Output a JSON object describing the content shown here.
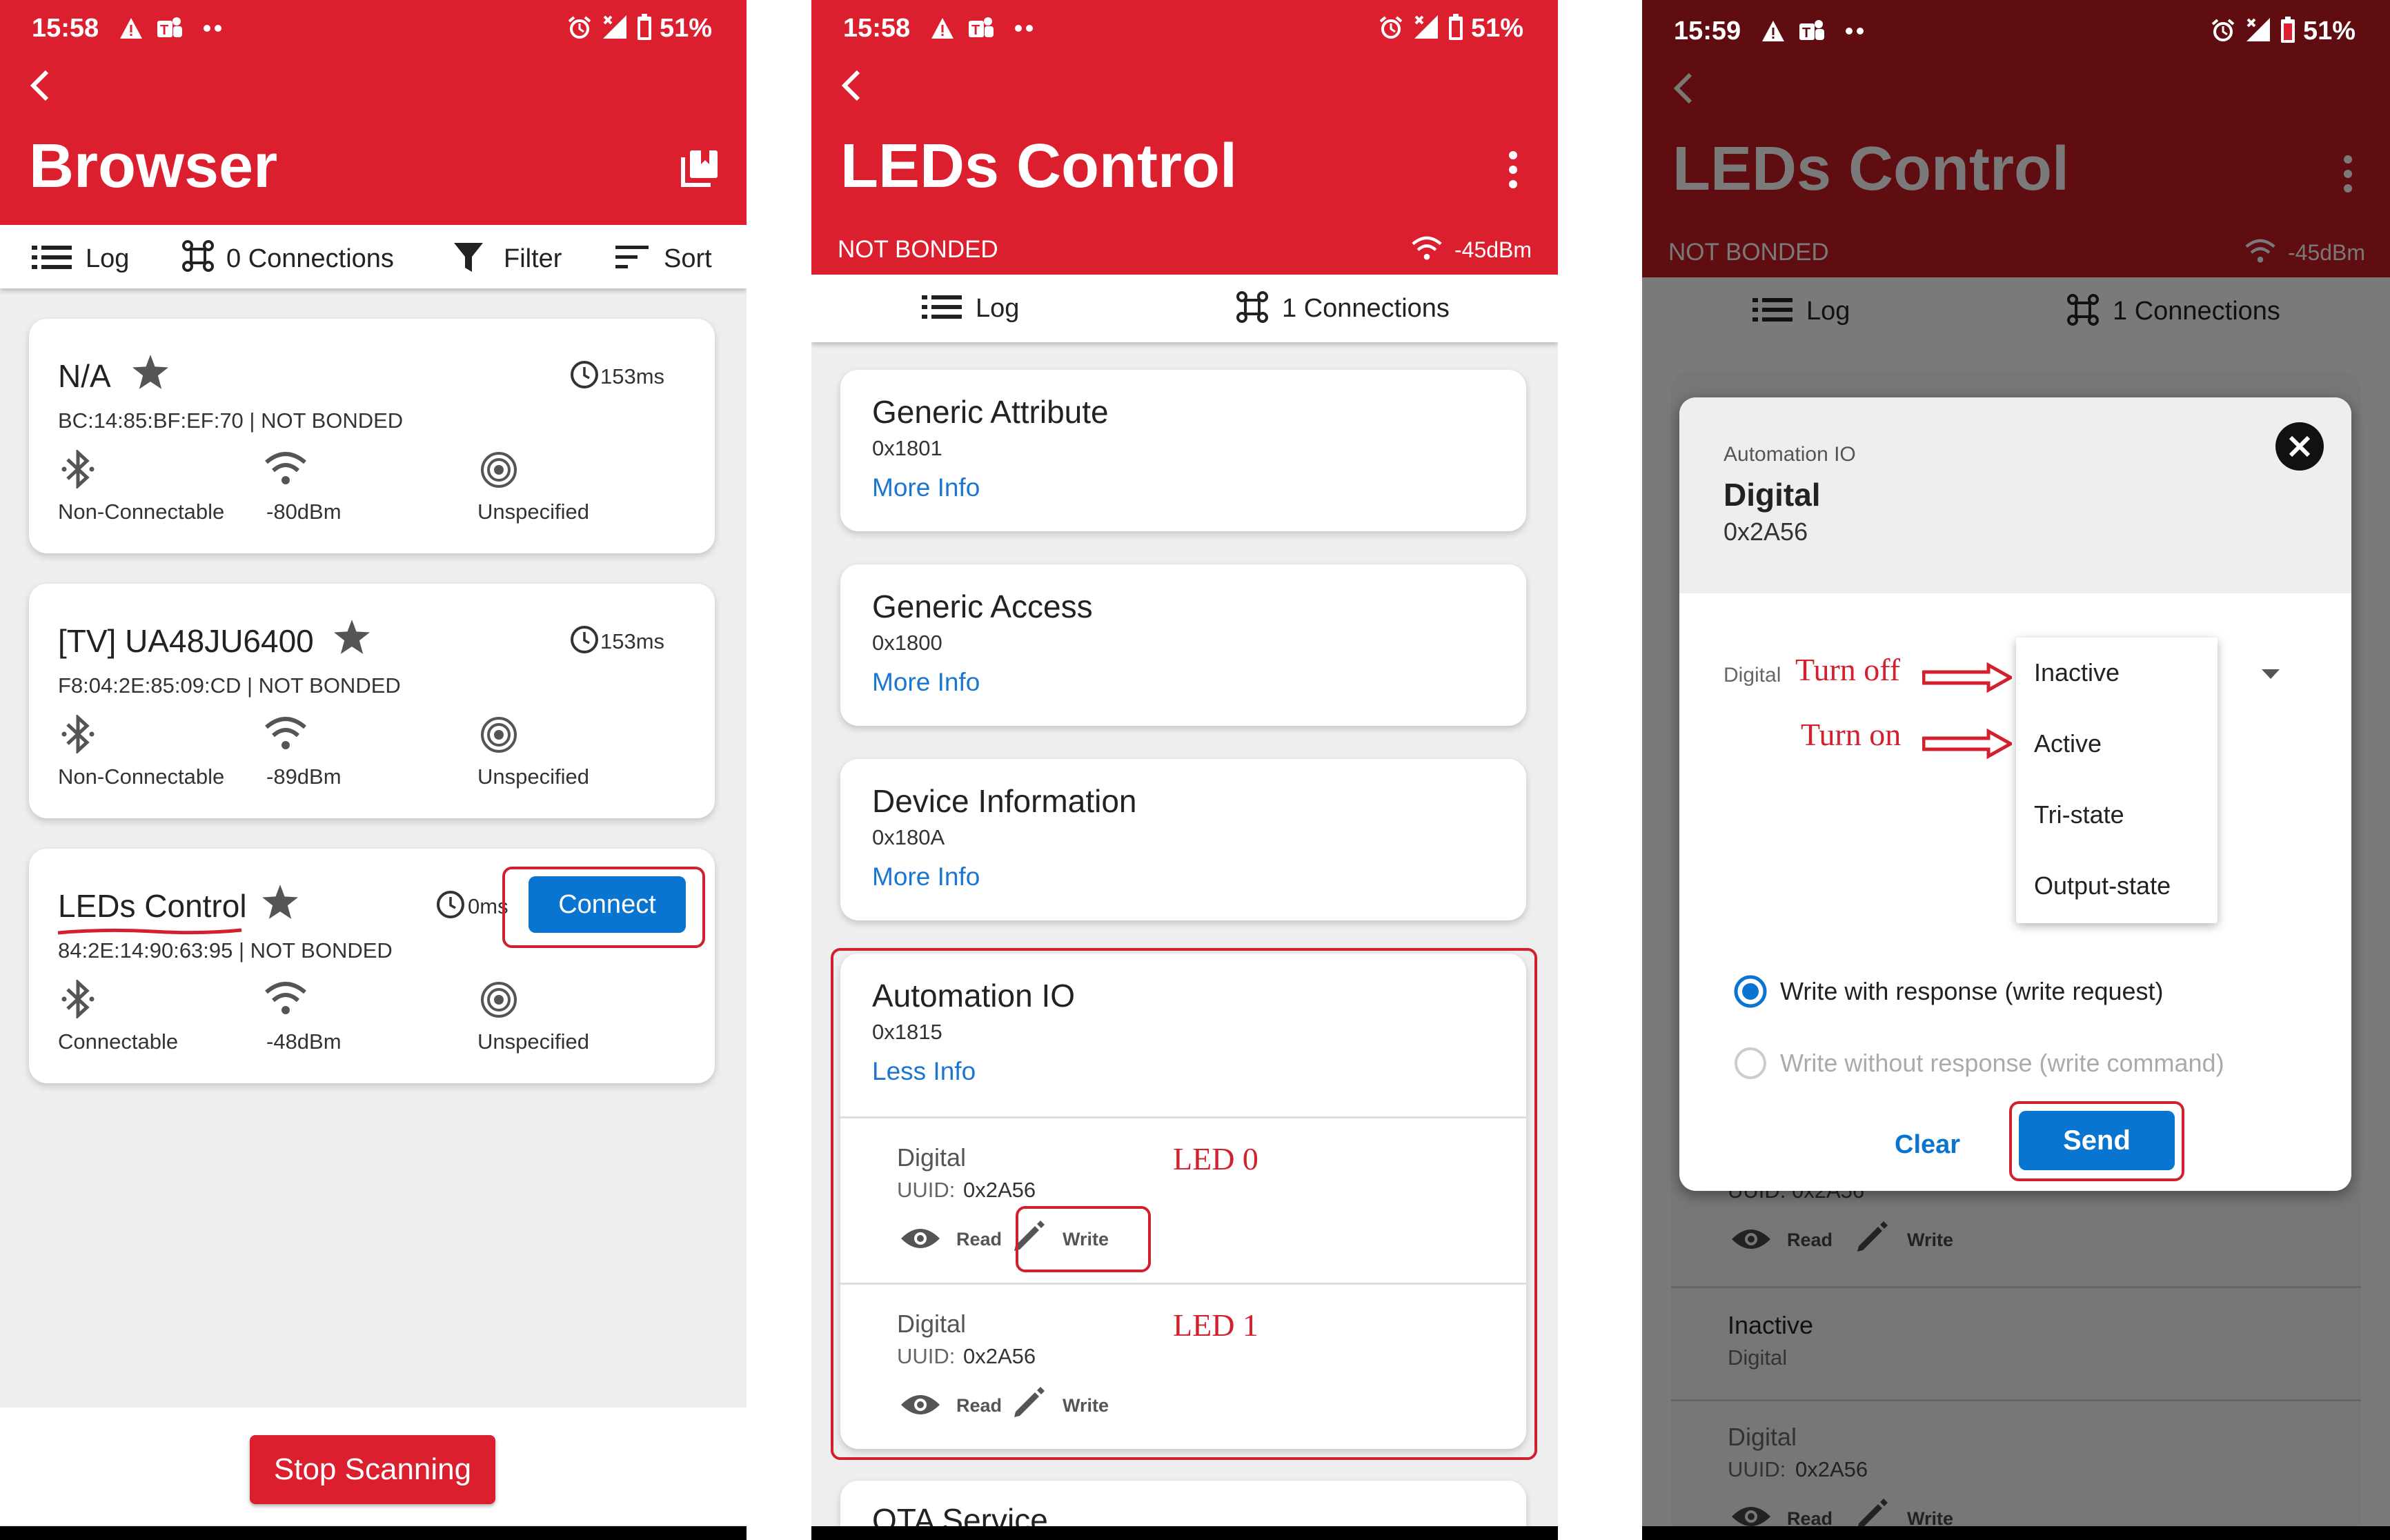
{
  "status_bar": [
    {
      "time": "15:58",
      "battery": "51%"
    },
    {
      "time": "15:58",
      "battery": "51%"
    },
    {
      "time": "15:59",
      "battery": "51%"
    }
  ],
  "browser": {
    "title": "Browser",
    "tabs": {
      "log": "Log",
      "connections": "0 Connections",
      "filter": "Filter",
      "sort": "Sort"
    },
    "devices": [
      {
        "name": "N/A",
        "interval": "153ms",
        "info": "BC:14:85:BF:EF:70 | NOT BONDED",
        "connectable": "Non-Connectable",
        "rssi": "-80dBm",
        "type": "Unspecified"
      },
      {
        "name": "[TV] UA48JU6400",
        "interval": "153ms",
        "info": "F8:04:2E:85:09:CD | NOT BONDED",
        "connectable": "Non-Connectable",
        "rssi": "-89dBm",
        "type": "Unspecified"
      },
      {
        "name": "LEDs Control",
        "interval": "0ms",
        "info": "84:2E:14:90:63:95 | NOT BONDED",
        "connectable": "Connectable",
        "rssi": "-48dBm",
        "type": "Unspecified",
        "connect_label": "Connect"
      }
    ],
    "stop_label": "Stop Scanning"
  },
  "leds": {
    "title": "LEDs Control",
    "bond": "NOT BONDED",
    "rssi": "-45dBm",
    "tabs": {
      "log": "Log",
      "connections": "1 Connections"
    },
    "services": [
      {
        "name": "Generic Attribute",
        "uuid": "0x1801",
        "link": "More Info"
      },
      {
        "name": "Generic Access",
        "uuid": "0x1800",
        "link": "More Info"
      },
      {
        "name": "Device Information",
        "uuid": "0x180A",
        "link": "More Info"
      },
      {
        "name": "Automation IO",
        "uuid": "0x1815",
        "link": "Less Info"
      }
    ],
    "characteristics": [
      {
        "name": "Digital",
        "uuid_label": "UUID:",
        "uuid": "0x2A56",
        "read": "Read",
        "write": "Write",
        "annotation": "LED 0"
      },
      {
        "name": "Digital",
        "uuid_label": "UUID:",
        "uuid": "0x2A56",
        "read": "Read",
        "write": "Write",
        "annotation": "LED 1"
      }
    ],
    "next_service": "OTA Service"
  },
  "dialog_screen": {
    "title": "LEDs Control",
    "bond": "NOT BONDED",
    "rssi": "-45dBm",
    "tabs": {
      "log": "Log",
      "connections": "1 Connections"
    },
    "behind": {
      "uuid_partial": "UUID: 0x2A56",
      "read": "Read",
      "write": "Write",
      "inactive": "Inactive",
      "inactive_sub": "Digital",
      "digital": "Digital",
      "digital_uuid_label": "UUID:",
      "digital_uuid": "0x2A56"
    },
    "dialog": {
      "service": "Automation IO",
      "name": "Digital",
      "uuid": "0x2A56",
      "field_label": "Digital",
      "options": [
        "Inactive",
        "Active",
        "Tri-state",
        "Output-state"
      ],
      "anno_off": "Turn off",
      "anno_on": "Turn on",
      "radio_with": "Write with response (write request)",
      "radio_without": "Write without response (write command)",
      "clear": "Clear",
      "send": "Send"
    }
  },
  "colors": {
    "brand_red": "#dc1f2e",
    "link_blue": "#1976d2",
    "button_blue": "#0a74d1",
    "annotation_red": "#d3202f"
  }
}
